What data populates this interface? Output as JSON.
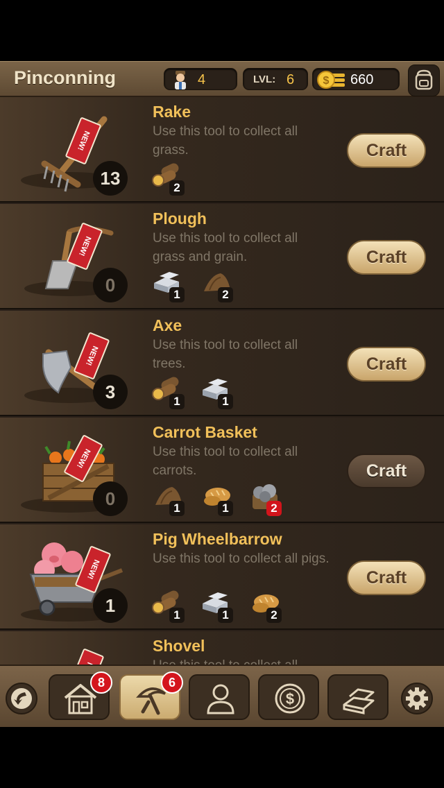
{
  "header": {
    "town_name": "Pinconning",
    "workers": "4",
    "level_label": "LVL:",
    "level": "6",
    "coins": "660"
  },
  "craft_label": "Craft",
  "new_tag": "NEW!",
  "tools": [
    {
      "name": "Rake",
      "description": "Use this tool to collect all grass.",
      "count": "13",
      "resources": [
        {
          "icon": "wood-icon",
          "qty": "2"
        }
      ]
    },
    {
      "name": "Plough",
      "description": "Use this tool to collect all grass and grain.",
      "count": "0",
      "resources": [
        {
          "icon": "iron-icon",
          "qty": "1"
        },
        {
          "icon": "wood-icon",
          "qty": "2"
        }
      ]
    },
    {
      "name": "Axe",
      "description": "Use this tool to collect all trees.",
      "count": "3",
      "resources": [
        {
          "icon": "wood-icon",
          "qty": "1"
        },
        {
          "icon": "iron-icon",
          "qty": "1"
        }
      ]
    },
    {
      "name": "Carrot Basket",
      "description": "Use this tool to collect all carrots.",
      "count": "0",
      "resources": [
        {
          "icon": "wood-icon",
          "qty": "1"
        },
        {
          "icon": "bread-icon",
          "qty": "1"
        },
        {
          "icon": "stone-icon",
          "qty": "2",
          "insufficient": true
        }
      ]
    },
    {
      "name": "Pig Wheelbarrow",
      "description": "Use this tool to collect all pigs.",
      "count": "1",
      "resources": [
        {
          "icon": "wood-icon",
          "qty": "1"
        },
        {
          "icon": "iron-icon",
          "qty": "1"
        },
        {
          "icon": "bread-icon",
          "qty": "2"
        }
      ]
    },
    {
      "name": "Shovel",
      "description": "Use this tool to collect all"
    }
  ],
  "nav": {
    "home_badge": "8",
    "tools_badge": "6"
  },
  "colors": {
    "accent_gold": "#f1c05a",
    "badge_red": "#d4151d",
    "wood_brown": "#6b5238"
  }
}
